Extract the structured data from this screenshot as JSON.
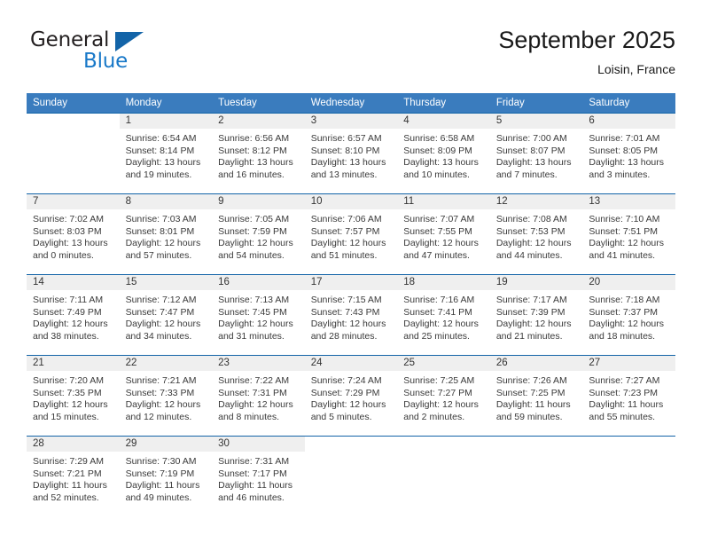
{
  "brand": {
    "name_part1": "General",
    "name_part2": "Blue",
    "triangle_color": "#1364a8",
    "blue_color": "#1878c8"
  },
  "header": {
    "title": "September 2025",
    "location": "Loisin, France"
  },
  "theme": {
    "header_blue": "#3a7cbe",
    "row_rule_blue": "#1364a8",
    "daynum_band": "#efefef"
  },
  "weekdays": [
    "Sunday",
    "Monday",
    "Tuesday",
    "Wednesday",
    "Thursday",
    "Friday",
    "Saturday"
  ],
  "weeks": [
    [
      {
        "day": "",
        "sunrise": "",
        "sunset": "",
        "daylight1": "",
        "daylight2": ""
      },
      {
        "day": "1",
        "sunrise": "Sunrise: 6:54 AM",
        "sunset": "Sunset: 8:14 PM",
        "daylight1": "Daylight: 13 hours",
        "daylight2": "and 19 minutes."
      },
      {
        "day": "2",
        "sunrise": "Sunrise: 6:56 AM",
        "sunset": "Sunset: 8:12 PM",
        "daylight1": "Daylight: 13 hours",
        "daylight2": "and 16 minutes."
      },
      {
        "day": "3",
        "sunrise": "Sunrise: 6:57 AM",
        "sunset": "Sunset: 8:10 PM",
        "daylight1": "Daylight: 13 hours",
        "daylight2": "and 13 minutes."
      },
      {
        "day": "4",
        "sunrise": "Sunrise: 6:58 AM",
        "sunset": "Sunset: 8:09 PM",
        "daylight1": "Daylight: 13 hours",
        "daylight2": "and 10 minutes."
      },
      {
        "day": "5",
        "sunrise": "Sunrise: 7:00 AM",
        "sunset": "Sunset: 8:07 PM",
        "daylight1": "Daylight: 13 hours",
        "daylight2": "and 7 minutes."
      },
      {
        "day": "6",
        "sunrise": "Sunrise: 7:01 AM",
        "sunset": "Sunset: 8:05 PM",
        "daylight1": "Daylight: 13 hours",
        "daylight2": "and 3 minutes."
      }
    ],
    [
      {
        "day": "7",
        "sunrise": "Sunrise: 7:02 AM",
        "sunset": "Sunset: 8:03 PM",
        "daylight1": "Daylight: 13 hours",
        "daylight2": "and 0 minutes."
      },
      {
        "day": "8",
        "sunrise": "Sunrise: 7:03 AM",
        "sunset": "Sunset: 8:01 PM",
        "daylight1": "Daylight: 12 hours",
        "daylight2": "and 57 minutes."
      },
      {
        "day": "9",
        "sunrise": "Sunrise: 7:05 AM",
        "sunset": "Sunset: 7:59 PM",
        "daylight1": "Daylight: 12 hours",
        "daylight2": "and 54 minutes."
      },
      {
        "day": "10",
        "sunrise": "Sunrise: 7:06 AM",
        "sunset": "Sunset: 7:57 PM",
        "daylight1": "Daylight: 12 hours",
        "daylight2": "and 51 minutes."
      },
      {
        "day": "11",
        "sunrise": "Sunrise: 7:07 AM",
        "sunset": "Sunset: 7:55 PM",
        "daylight1": "Daylight: 12 hours",
        "daylight2": "and 47 minutes."
      },
      {
        "day": "12",
        "sunrise": "Sunrise: 7:08 AM",
        "sunset": "Sunset: 7:53 PM",
        "daylight1": "Daylight: 12 hours",
        "daylight2": "and 44 minutes."
      },
      {
        "day": "13",
        "sunrise": "Sunrise: 7:10 AM",
        "sunset": "Sunset: 7:51 PM",
        "daylight1": "Daylight: 12 hours",
        "daylight2": "and 41 minutes."
      }
    ],
    [
      {
        "day": "14",
        "sunrise": "Sunrise: 7:11 AM",
        "sunset": "Sunset: 7:49 PM",
        "daylight1": "Daylight: 12 hours",
        "daylight2": "and 38 minutes."
      },
      {
        "day": "15",
        "sunrise": "Sunrise: 7:12 AM",
        "sunset": "Sunset: 7:47 PM",
        "daylight1": "Daylight: 12 hours",
        "daylight2": "and 34 minutes."
      },
      {
        "day": "16",
        "sunrise": "Sunrise: 7:13 AM",
        "sunset": "Sunset: 7:45 PM",
        "daylight1": "Daylight: 12 hours",
        "daylight2": "and 31 minutes."
      },
      {
        "day": "17",
        "sunrise": "Sunrise: 7:15 AM",
        "sunset": "Sunset: 7:43 PM",
        "daylight1": "Daylight: 12 hours",
        "daylight2": "and 28 minutes."
      },
      {
        "day": "18",
        "sunrise": "Sunrise: 7:16 AM",
        "sunset": "Sunset: 7:41 PM",
        "daylight1": "Daylight: 12 hours",
        "daylight2": "and 25 minutes."
      },
      {
        "day": "19",
        "sunrise": "Sunrise: 7:17 AM",
        "sunset": "Sunset: 7:39 PM",
        "daylight1": "Daylight: 12 hours",
        "daylight2": "and 21 minutes."
      },
      {
        "day": "20",
        "sunrise": "Sunrise: 7:18 AM",
        "sunset": "Sunset: 7:37 PM",
        "daylight1": "Daylight: 12 hours",
        "daylight2": "and 18 minutes."
      }
    ],
    [
      {
        "day": "21",
        "sunrise": "Sunrise: 7:20 AM",
        "sunset": "Sunset: 7:35 PM",
        "daylight1": "Daylight: 12 hours",
        "daylight2": "and 15 minutes."
      },
      {
        "day": "22",
        "sunrise": "Sunrise: 7:21 AM",
        "sunset": "Sunset: 7:33 PM",
        "daylight1": "Daylight: 12 hours",
        "daylight2": "and 12 minutes."
      },
      {
        "day": "23",
        "sunrise": "Sunrise: 7:22 AM",
        "sunset": "Sunset: 7:31 PM",
        "daylight1": "Daylight: 12 hours",
        "daylight2": "and 8 minutes."
      },
      {
        "day": "24",
        "sunrise": "Sunrise: 7:24 AM",
        "sunset": "Sunset: 7:29 PM",
        "daylight1": "Daylight: 12 hours",
        "daylight2": "and 5 minutes."
      },
      {
        "day": "25",
        "sunrise": "Sunrise: 7:25 AM",
        "sunset": "Sunset: 7:27 PM",
        "daylight1": "Daylight: 12 hours",
        "daylight2": "and 2 minutes."
      },
      {
        "day": "26",
        "sunrise": "Sunrise: 7:26 AM",
        "sunset": "Sunset: 7:25 PM",
        "daylight1": "Daylight: 11 hours",
        "daylight2": "and 59 minutes."
      },
      {
        "day": "27",
        "sunrise": "Sunrise: 7:27 AM",
        "sunset": "Sunset: 7:23 PM",
        "daylight1": "Daylight: 11 hours",
        "daylight2": "and 55 minutes."
      }
    ],
    [
      {
        "day": "28",
        "sunrise": "Sunrise: 7:29 AM",
        "sunset": "Sunset: 7:21 PM",
        "daylight1": "Daylight: 11 hours",
        "daylight2": "and 52 minutes."
      },
      {
        "day": "29",
        "sunrise": "Sunrise: 7:30 AM",
        "sunset": "Sunset: 7:19 PM",
        "daylight1": "Daylight: 11 hours",
        "daylight2": "and 49 minutes."
      },
      {
        "day": "30",
        "sunrise": "Sunrise: 7:31 AM",
        "sunset": "Sunset: 7:17 PM",
        "daylight1": "Daylight: 11 hours",
        "daylight2": "and 46 minutes."
      },
      {
        "day": "",
        "sunrise": "",
        "sunset": "",
        "daylight1": "",
        "daylight2": ""
      },
      {
        "day": "",
        "sunrise": "",
        "sunset": "",
        "daylight1": "",
        "daylight2": ""
      },
      {
        "day": "",
        "sunrise": "",
        "sunset": "",
        "daylight1": "",
        "daylight2": ""
      },
      {
        "day": "",
        "sunrise": "",
        "sunset": "",
        "daylight1": "",
        "daylight2": ""
      }
    ]
  ]
}
